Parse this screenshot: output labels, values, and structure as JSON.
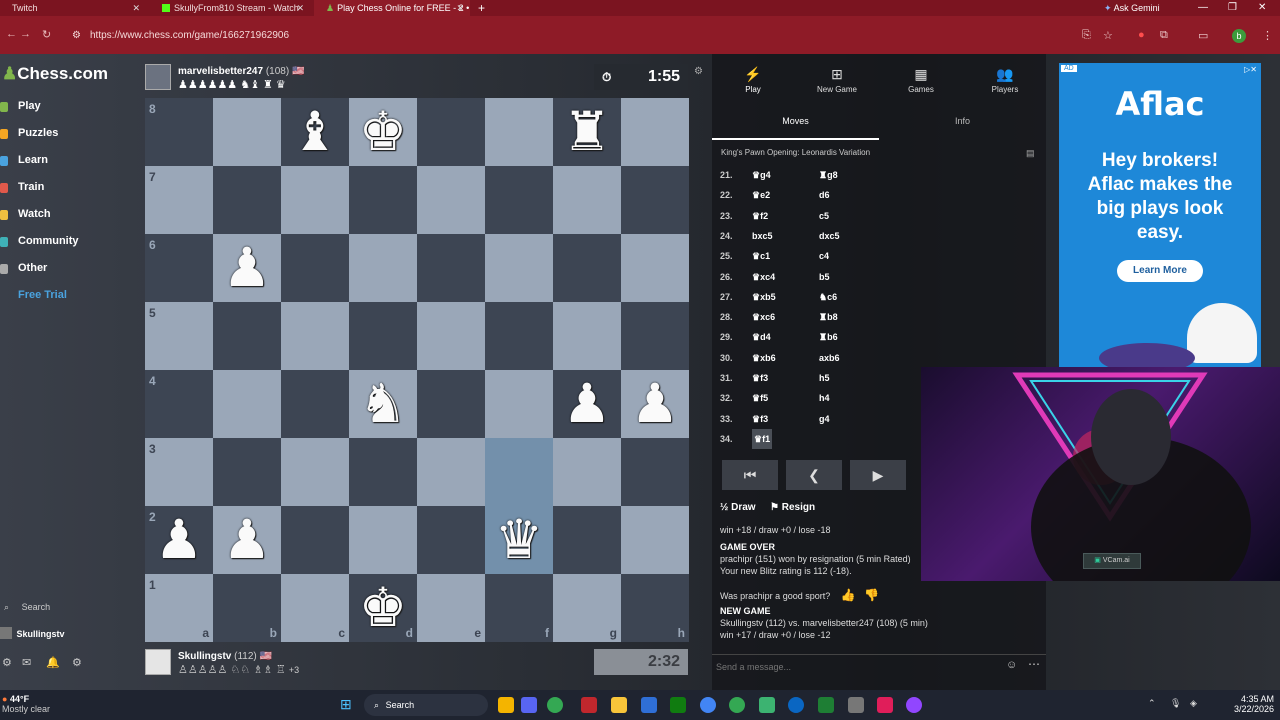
{
  "browser": {
    "tabs": [
      {
        "label": "Twitch",
        "icon_color": "#9146ff"
      },
      {
        "label": "SkullyFrom810 Stream - Watch",
        "icon_color": "#53fc18"
      },
      {
        "label": "Play Chess Online for FREE - 2 •",
        "icon_color": "#81b64c"
      }
    ],
    "new_tab": "+",
    "ask_gemini": "Ask Gemini",
    "url": "https://www.chess.com/game/166271962906",
    "profile_initial": "b"
  },
  "sidebar": {
    "logo": "Chess.com",
    "items": [
      {
        "label": "Play",
        "color": "#81b64c"
      },
      {
        "label": "Puzzles",
        "color": "#f5a623"
      },
      {
        "label": "Learn",
        "color": "#4aa3df"
      },
      {
        "label": "Train",
        "color": "#e0594b"
      },
      {
        "label": "Watch",
        "color": "#f0c040"
      },
      {
        "label": "Community",
        "color": "#3fb1b7"
      },
      {
        "label": "Other",
        "color": "#aaaaaa"
      }
    ],
    "free_trial": "Free Trial",
    "search": "Search",
    "username": "Skullingstv"
  },
  "top_player": {
    "name": "marvelisbetter247",
    "rating": "(108)",
    "captured": "♟♟♟♟♟♟ ♞♝ ♜ ♛",
    "clock": "1:55"
  },
  "bottom_player": {
    "name": "Skullingstv",
    "rating": "(112)",
    "captured": "♙♙♙♙♙ ♘♘ ♗♗ ♖",
    "advantage": "+3",
    "clock": "2:32"
  },
  "board": {
    "highlight": [
      "f3",
      "f2"
    ],
    "pieces": {
      "c8": "♝",
      "d8": "♚",
      "g8": "♜",
      "b6": "♟",
      "d4": "♞",
      "g4": "♟",
      "h4": "♟",
      "a2": "♟",
      "b2": "♟",
      "f2": "♛",
      "d1": "♚"
    }
  },
  "panel": {
    "tabs": [
      "Play",
      "New Game",
      "Games",
      "Players"
    ],
    "subtabs": [
      "Moves",
      "Info"
    ],
    "opening": "King's Pawn Opening: Leonardis Variation",
    "moves": [
      {
        "n": "21.",
        "w": "♛g4",
        "b": "♜g8"
      },
      {
        "n": "22.",
        "w": "♛e2",
        "b": "d6"
      },
      {
        "n": "23.",
        "w": "♛f2",
        "b": "c5"
      },
      {
        "n": "24.",
        "w": "bxc5",
        "b": "dxc5"
      },
      {
        "n": "25.",
        "w": "♛c1",
        "b": "c4"
      },
      {
        "n": "26.",
        "w": "♛xc4",
        "b": "b5"
      },
      {
        "n": "27.",
        "w": "♛xb5",
        "b": "♞c6"
      },
      {
        "n": "28.",
        "w": "♛xc6",
        "b": "♜b8"
      },
      {
        "n": "29.",
        "w": "♛d4",
        "b": "♜b6"
      },
      {
        "n": "30.",
        "w": "♛xb6",
        "b": "axb6"
      },
      {
        "n": "31.",
        "w": "♛f3",
        "b": "h5"
      },
      {
        "n": "32.",
        "w": "♛f5",
        "b": "h4"
      },
      {
        "n": "33.",
        "w": "♛f3",
        "b": "g4"
      },
      {
        "n": "34.",
        "w": "♛f1",
        "b": ""
      }
    ],
    "controls": [
      "⏮",
      "❮",
      "▶"
    ],
    "draw": "Draw",
    "resign": "Resign",
    "half": "½",
    "outcome_odds": "win +18 / draw +0 / lose -18",
    "game_over_title": "GAME OVER",
    "game_over_text": "prachipr (151) won by resignation (5 min Rated)",
    "rating_text": "Your new Blitz rating is 112 (-18).",
    "sport_question": "Was prachipr a good sport?",
    "new_game_title": "NEW GAME",
    "new_game_text": "Skullingstv (112) vs. marvelisbetter247 (108) (5 min)",
    "new_game_odds": "win +17 / draw +0 / lose -12",
    "chat_placeholder": "Send a message..."
  },
  "ad": {
    "badge": "AD",
    "brand": "Aflac",
    "headline": "Hey brokers! Aflac makes the big plays look easy.",
    "cta": "Learn More"
  },
  "webcam": {
    "watermark": "VCam.ai"
  },
  "taskbar": {
    "weather_temp": "44°F",
    "weather_desc": "Mostly clear",
    "search": "Search",
    "time": "4:35 AM",
    "date": "3/22/2026"
  }
}
